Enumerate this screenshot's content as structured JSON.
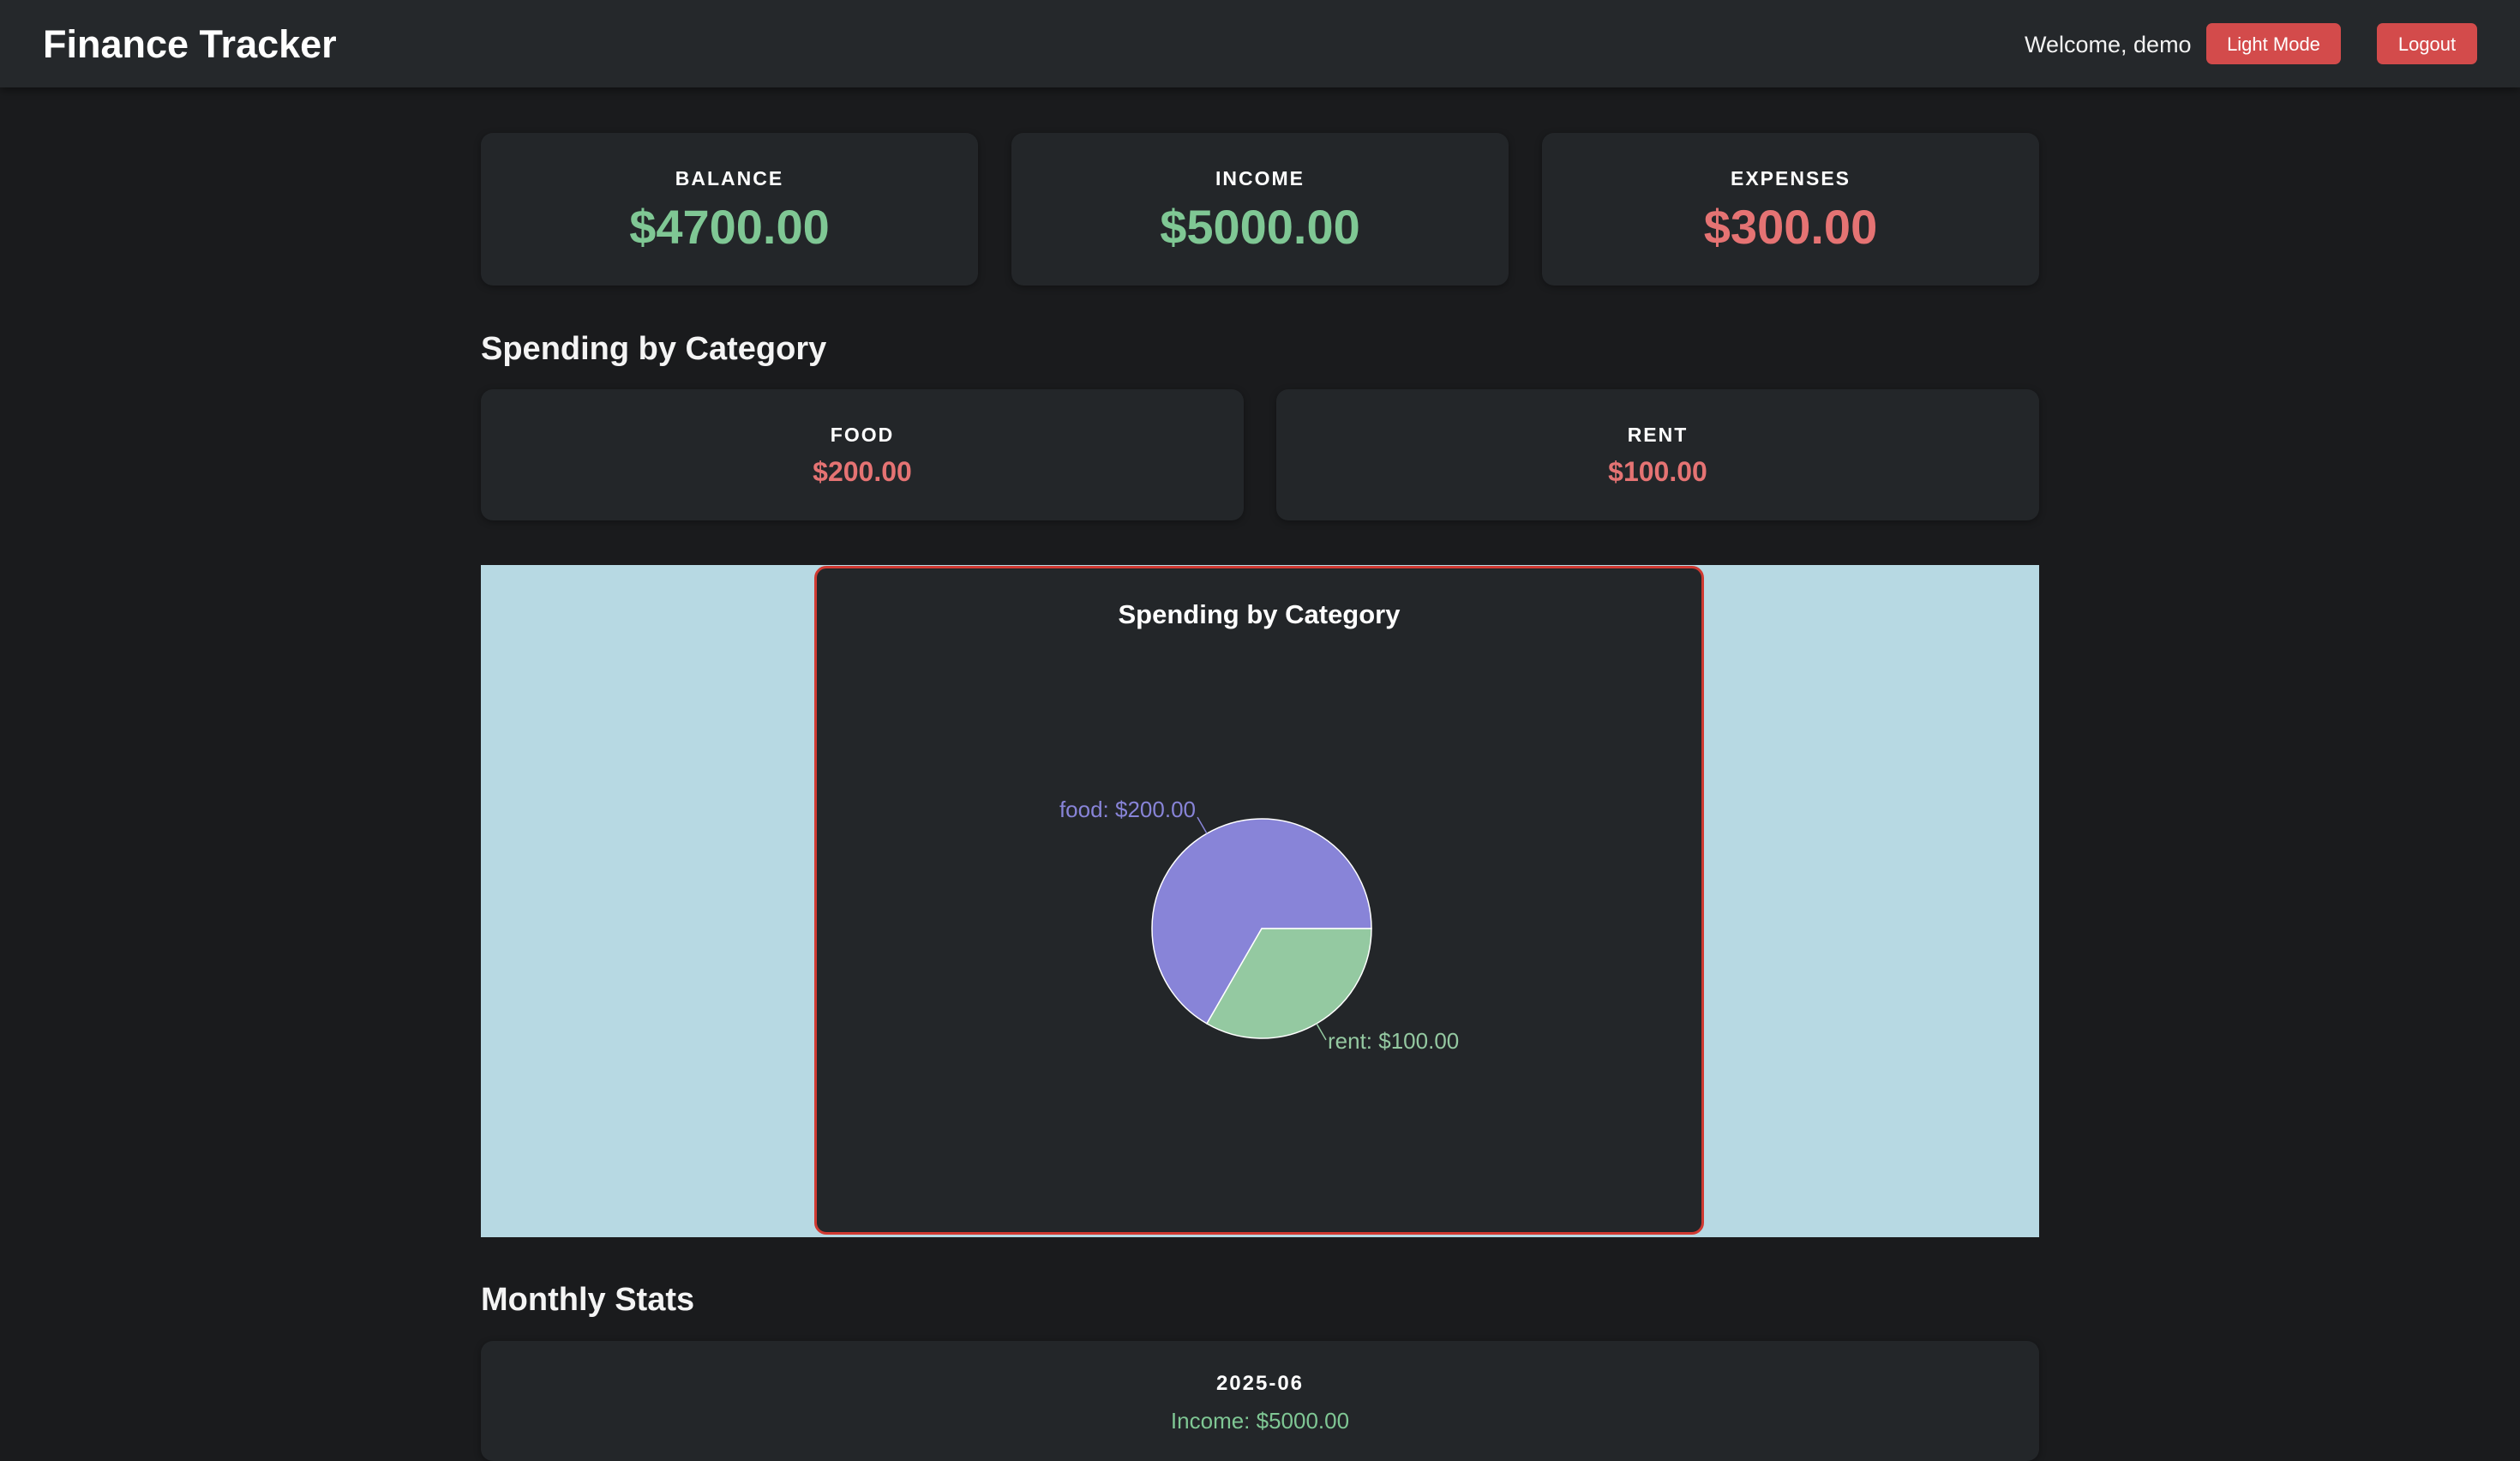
{
  "header": {
    "app_title": "Finance Tracker",
    "welcome": "Welcome, demo",
    "light_mode_label": "Light Mode",
    "logout_label": "Logout"
  },
  "summary": {
    "balance": {
      "label": "BALANCE",
      "value": "$4700.00"
    },
    "income": {
      "label": "INCOME",
      "value": "$5000.00"
    },
    "expenses": {
      "label": "EXPENSES",
      "value": "$300.00"
    }
  },
  "spending": {
    "title": "Spending by Category",
    "categories": [
      {
        "label": "FOOD",
        "value": "$200.00"
      },
      {
        "label": "RENT",
        "value": "$100.00"
      }
    ]
  },
  "chart_data": {
    "type": "pie",
    "title": "Spending by Category",
    "categories": [
      "food",
      "rent"
    ],
    "values": [
      200,
      100
    ],
    "data_labels": [
      "food: $200.00",
      "rent: $100.00"
    ],
    "colors": [
      "#8884d8",
      "#94c9a1"
    ]
  },
  "monthly": {
    "title": "Monthly Stats",
    "months": [
      {
        "label": "2025-06",
        "income": "Income: $5000.00"
      }
    ]
  },
  "colors": {
    "accent_button": "#d34b4b",
    "positive": "#7fc794",
    "negative": "#e57373",
    "chart_border": "#d03a32",
    "chart_backdrop": "#b7d9e3"
  }
}
